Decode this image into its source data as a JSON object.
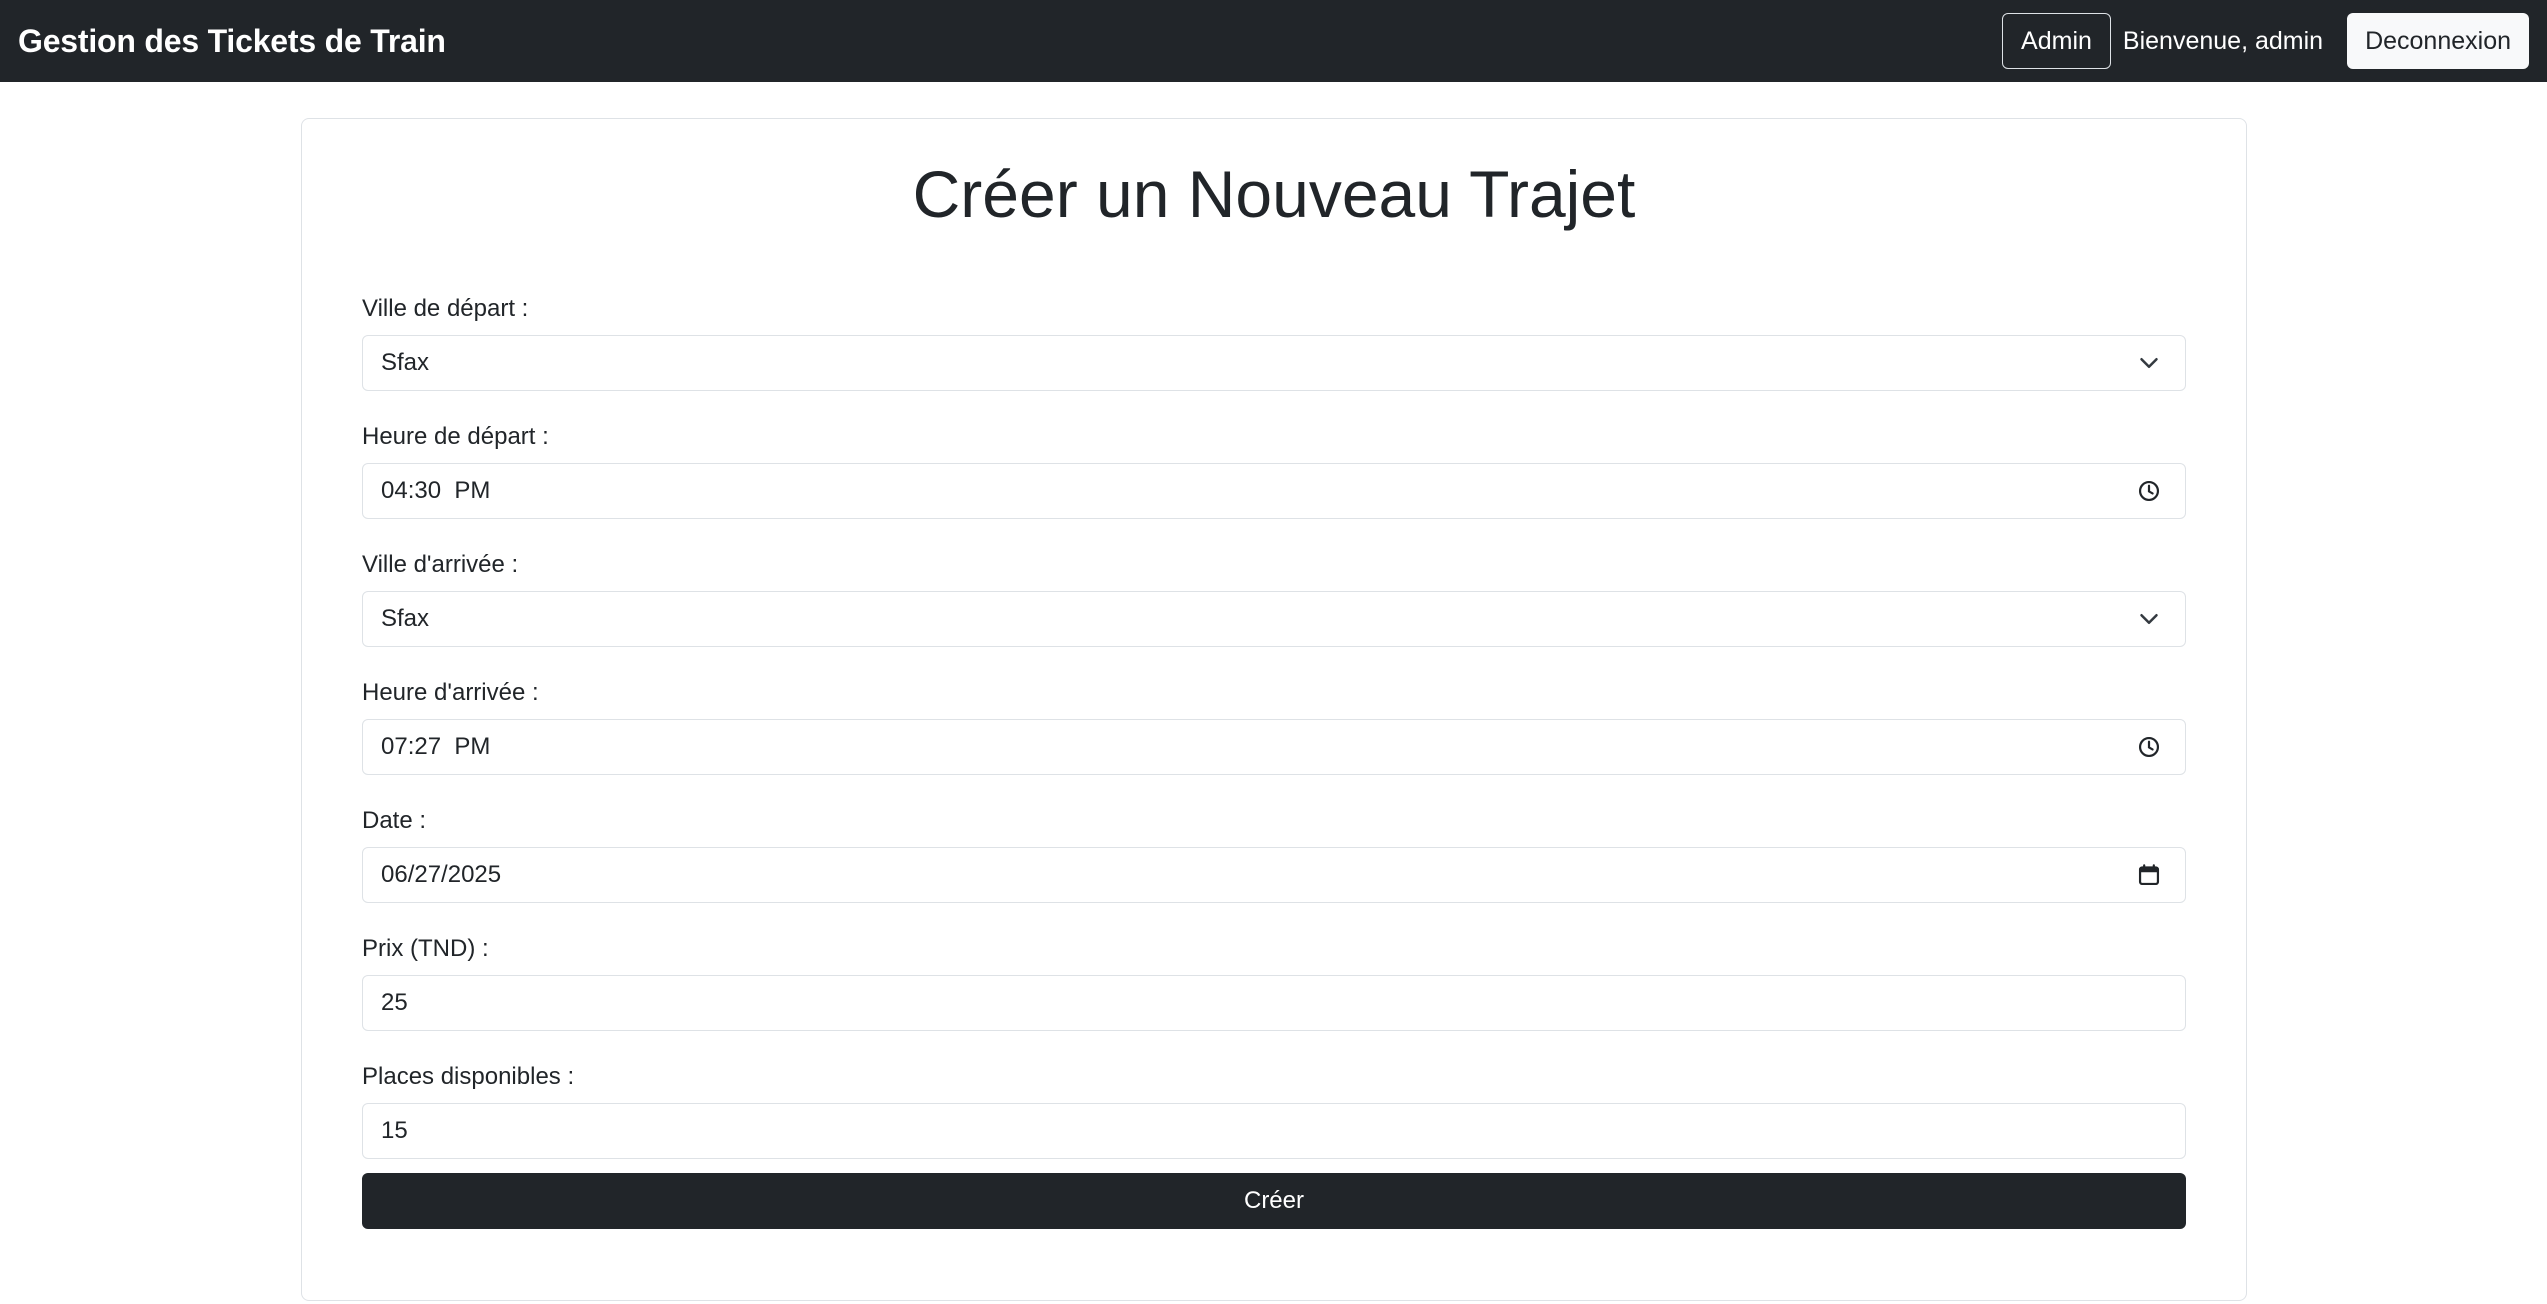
{
  "navbar": {
    "brand": "Gestion des Tickets de Train",
    "admin_label": "Admin",
    "welcome_text": "Bienvenue, admin",
    "logout_label": "Deconnexion",
    "background": "#212529"
  },
  "form": {
    "title": "Créer un Nouveau Trajet",
    "fields": [
      {
        "label": "Ville de départ :",
        "value": "Sfax",
        "type": "select",
        "icon": "chevron-down-icon"
      },
      {
        "label": "Heure de départ :",
        "value": "04:30  PM",
        "type": "time",
        "icon": "clock-icon"
      },
      {
        "label": "Ville d'arrivée :",
        "value": "Sfax",
        "type": "select",
        "icon": "chevron-down-icon"
      },
      {
        "label": "Heure d'arrivée :",
        "value": "07:27  PM",
        "type": "time",
        "icon": "clock-icon"
      },
      {
        "label": "Date :",
        "value": "06/27/2025",
        "type": "date",
        "icon": "calendar-icon"
      },
      {
        "label": "Prix (TND) :",
        "value": "25",
        "type": "number",
        "icon": ""
      },
      {
        "label": "Places disponibles :",
        "value": "15",
        "type": "number",
        "icon": ""
      }
    ],
    "submit_label": "Créer",
    "submit_color": "#212529"
  }
}
